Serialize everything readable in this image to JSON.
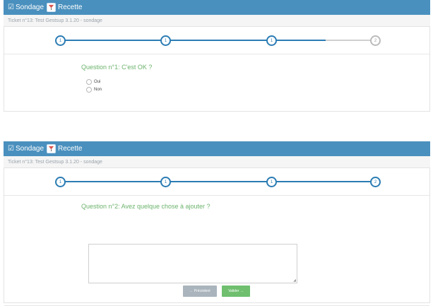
{
  "surveys": [
    {
      "app_title": "Sondage",
      "app_name": "Recette",
      "ticket": "Ticket n°13: Test Gestsup 3.1.20 - sondage",
      "steps": [
        "1",
        "1",
        "1",
        "2"
      ],
      "question": "Question n°1: C'est OK ?",
      "options": [
        "Oui",
        "Non"
      ]
    },
    {
      "app_title": "Sondage",
      "app_name": "Recette",
      "ticket": "Ticket n°13: Test Gestsup 3.1.20 - sondage",
      "steps": [
        "1",
        "1",
        "1",
        "2"
      ],
      "question": "Question n°2: Avez quelque chose à ajouter ?",
      "answer_value": "",
      "buttons": {
        "previous": "Précédent",
        "validate": "Valider"
      }
    }
  ],
  "colors": {
    "header": "#4a90be",
    "step_active": "#2b7cb4",
    "step_todo": "#bbbbbb",
    "question": "#6cb36c",
    "validate": "#6fbf6f",
    "previous": "#a9b4bc"
  },
  "icons": {
    "title": "check-square-icon",
    "app": "cocktail-icon",
    "previous": "arrow-left-icon",
    "validate": "arrow-right-icon",
    "resize": "resize-grip-icon"
  }
}
